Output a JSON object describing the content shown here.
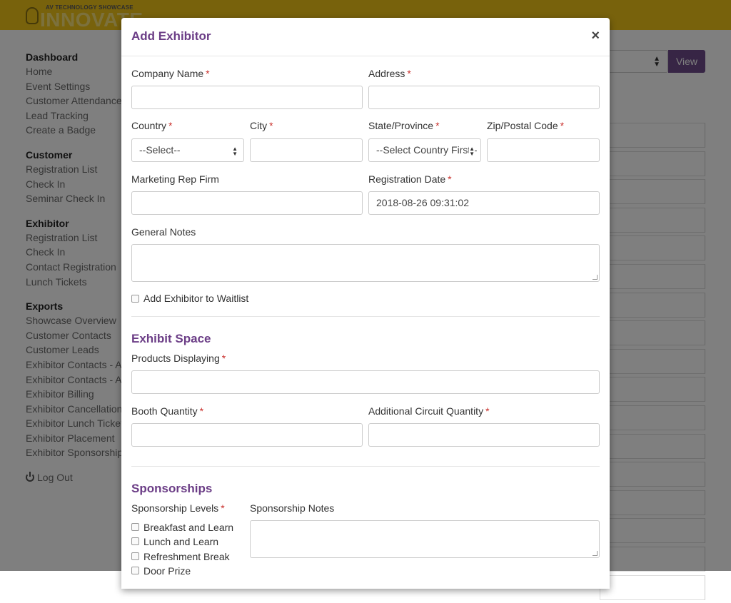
{
  "header": {
    "logo_sup": "AV TECHNOLOGY SHOWCASE",
    "logo_main": "INNOVATE"
  },
  "sidebar": {
    "groups": [
      {
        "title": "Dashboard",
        "items": [
          "Home",
          "Event Settings",
          "Customer Attendance",
          "Lead Tracking",
          "Create a Badge"
        ]
      },
      {
        "title": "Customer",
        "items": [
          "Registration List",
          "Check In",
          "Seminar Check In"
        ]
      },
      {
        "title": "Exhibitor",
        "items": [
          "Registration List",
          "Check In",
          "Contact Registration",
          "Lunch Tickets"
        ]
      },
      {
        "title": "Exports",
        "items": [
          "Showcase Overview",
          "Customer Contacts",
          "Customer Leads",
          "Exhibitor Contacts - All",
          "Exhibitor Contacts - Att",
          "Exhibitor Billing",
          "Exhibitor Cancellations",
          "Exhibitor Lunch Tickets",
          "Exhibitor Placement",
          "Exhibitor Sponsorships"
        ]
      }
    ],
    "logout": "Log Out"
  },
  "background": {
    "view_button": "View"
  },
  "modal": {
    "title": "Add Exhibitor",
    "close": "×",
    "required_mark": "*",
    "fields": {
      "company_name": {
        "label": "Company Name",
        "value": ""
      },
      "address": {
        "label": "Address",
        "value": ""
      },
      "country": {
        "label": "Country",
        "value": "--Select--"
      },
      "city": {
        "label": "City",
        "value": ""
      },
      "state": {
        "label": "State/Province",
        "value": "--Select Country First--"
      },
      "zip": {
        "label": "Zip/Postal Code",
        "value": ""
      },
      "marketing_rep": {
        "label": "Marketing Rep Firm",
        "value": ""
      },
      "registration_date": {
        "label": "Registration Date",
        "value": "2018-08-26 09:31:02"
      },
      "general_notes": {
        "label": "General Notes"
      },
      "waitlist": {
        "label": "Add Exhibitor to Waitlist",
        "checked": false
      }
    },
    "exhibit_space": {
      "title": "Exhibit Space",
      "products": {
        "label": "Products Displaying",
        "value": ""
      },
      "booth_quantity": {
        "label": "Booth Quantity",
        "value": ""
      },
      "circuit_quantity": {
        "label": "Additional Circuit Quantity",
        "value": ""
      }
    },
    "sponsorships": {
      "title": "Sponsorships",
      "levels_label": "Sponsorship Levels",
      "notes_label": "Sponsorship Notes",
      "levels": [
        "Breakfast and Learn",
        "Lunch and Learn",
        "Refreshment Break",
        "Door Prize"
      ]
    }
  },
  "colors": {
    "topbar": "#f0c419",
    "accent": "#6b3d86",
    "required": "#c9302c",
    "view_button": "#6e4a8a"
  }
}
